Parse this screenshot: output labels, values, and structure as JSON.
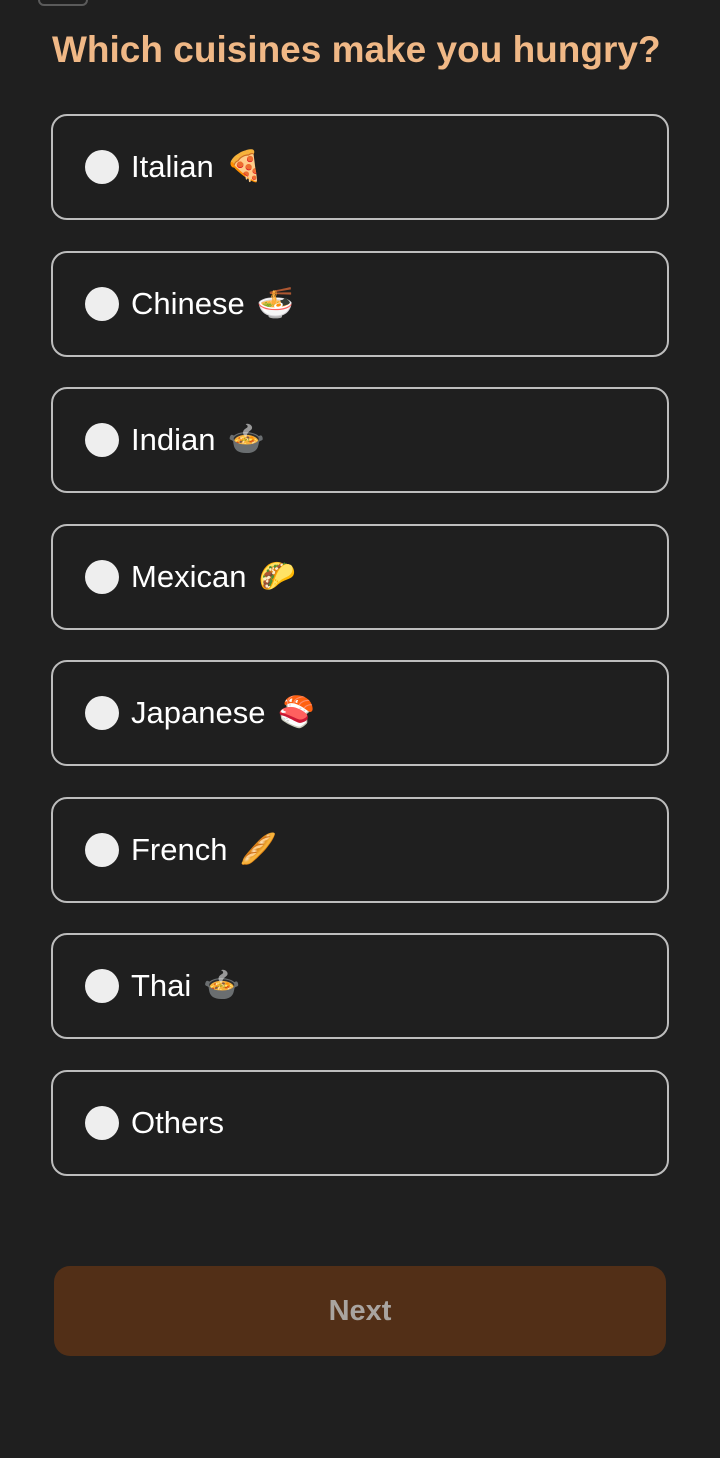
{
  "question": {
    "title": "Which cuisines make you hungry?"
  },
  "options": [
    {
      "label": "Italian",
      "emoji": "🍕",
      "icon": "pizza-icon",
      "selected": false
    },
    {
      "label": "Chinese",
      "emoji": "🍜",
      "icon": "noodle-bowl-icon",
      "selected": false
    },
    {
      "label": "Indian",
      "emoji": "🍲",
      "icon": "curry-pot-icon",
      "selected": false
    },
    {
      "label": "Mexican",
      "emoji": "🌮",
      "icon": "taco-icon",
      "selected": false
    },
    {
      "label": "Japanese",
      "emoji": "🍣",
      "icon": "sushi-icon",
      "selected": false
    },
    {
      "label": "French",
      "emoji": "🥖",
      "icon": "baguette-icon",
      "selected": false
    },
    {
      "label": "Thai",
      "emoji": "🍲",
      "icon": "soup-pot-icon",
      "selected": false
    },
    {
      "label": "Others",
      "emoji": "",
      "icon": "",
      "selected": false
    }
  ],
  "next_button": {
    "label": "Next",
    "enabled": false
  },
  "colors": {
    "background": "#1f1f1f",
    "title": "#f0b886",
    "option_border": "#bdbdbd",
    "option_text": "#ffffff",
    "radio_fill": "#eeeeee",
    "button_bg": "#522f17",
    "button_text": "#a9a4a0"
  }
}
